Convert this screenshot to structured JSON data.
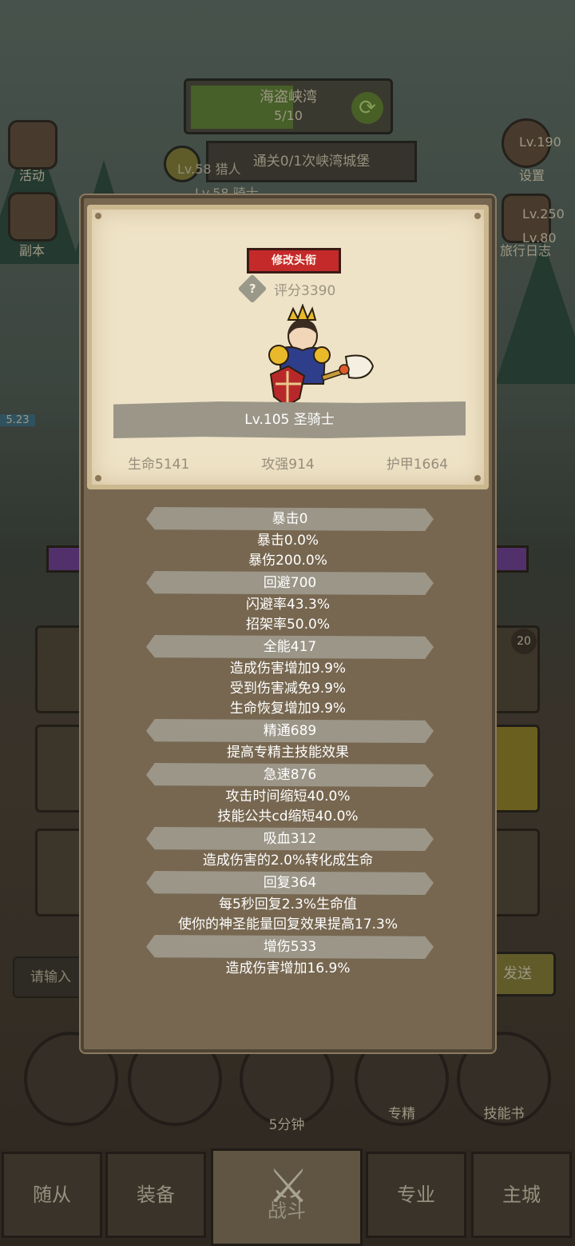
{
  "background": {
    "stage": {
      "name": "海盗峡湾",
      "progress": "5/10"
    },
    "quest": "通关0/1次峡湾城堡",
    "party": [
      "Lv.58 猎人",
      "Lv.58 骑士"
    ],
    "left_menu": [
      "活动",
      "副本"
    ],
    "right_menu": [
      "设置",
      "旅行日志"
    ],
    "side_levels": [
      "Lv.190",
      "Lv.250",
      "Lv.80"
    ],
    "hp_tag": "5.23",
    "slot_badge": "20",
    "chat_placeholder": "请输入",
    "send_label": "发送",
    "bottom_buttons": [
      "5分钟",
      "专精",
      "技能书"
    ],
    "nav_tabs": [
      "随从",
      "装备",
      "战斗",
      "专业",
      "主城"
    ]
  },
  "panel": {
    "rename_button": "修改头衔",
    "score": "评分3390",
    "hero_name": "Lv.105 圣骑士",
    "base_stats": [
      "生命5141",
      "攻强914",
      "护甲1664"
    ],
    "attributes": [
      {
        "name": "暴击0",
        "lines": [
          "暴击0.0%",
          "暴伤200.0%"
        ]
      },
      {
        "name": "回避700",
        "lines": [
          "闪避率43.3%",
          "招架率50.0%"
        ]
      },
      {
        "name": "全能417",
        "lines": [
          "造成伤害增加9.9%",
          "受到伤害减免9.9%",
          "生命恢复增加9.9%"
        ]
      },
      {
        "name": "精通689",
        "lines": [
          "提高专精主技能效果"
        ]
      },
      {
        "name": "急速876",
        "lines": [
          "攻击时间缩短40.0%",
          "技能公共cd缩短40.0%"
        ]
      },
      {
        "name": "吸血312",
        "lines": [
          "造成伤害的2.0%转化成生命"
        ]
      },
      {
        "name": "回复364",
        "lines": [
          "每5秒回复2.3%生命值",
          "使你的神圣能量回复效果提高17.3%"
        ]
      },
      {
        "name": "增伤533",
        "lines": [
          "造成伤害增加16.9%"
        ]
      }
    ]
  },
  "colors": {
    "panel": "#776750",
    "parchment": "#efe3c7",
    "button_red": "#c42a2a",
    "bar_gray": "#9b9688"
  }
}
